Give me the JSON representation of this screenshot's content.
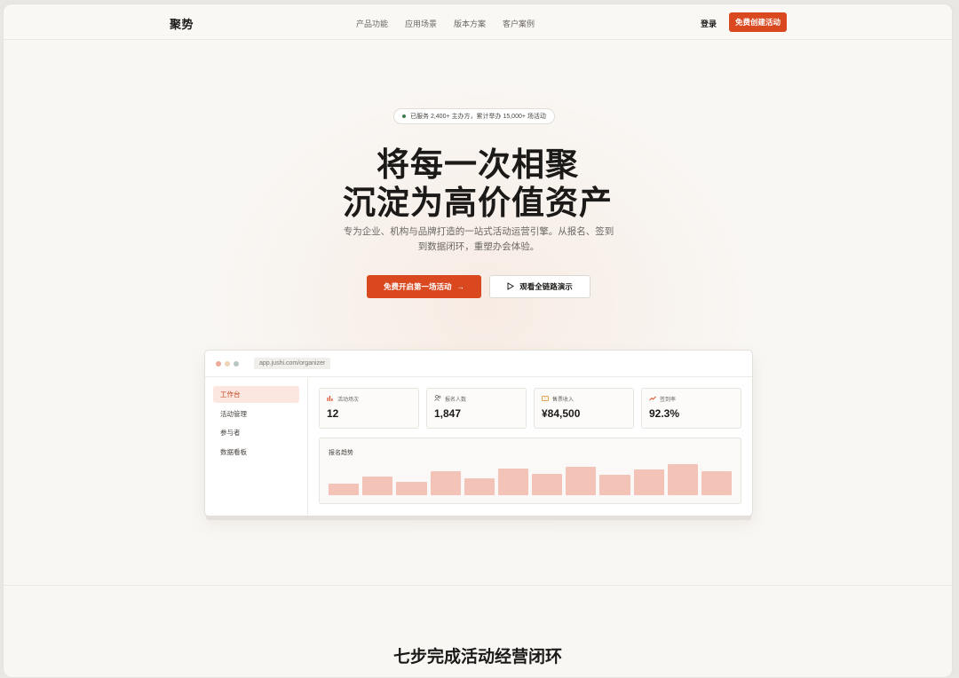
{
  "nav": {
    "logo": "聚势",
    "links": [
      "产品功能",
      "应用场景",
      "版本方案",
      "客户案例"
    ],
    "login": "登录",
    "cta": "免费创建活动"
  },
  "hero": {
    "badge": "已服务 2,400+ 主办方，累计举办 15,000+ 场活动",
    "title_line1": "将每一次相聚",
    "title_line2": "沉淀为高价值资产",
    "subtitle": "专为企业、机构与品牌打造的一站式活动运营引擎。从报名、签到到数据闭环，重塑办会体验。",
    "primary_button": "免费开启第一场活动",
    "secondary_button": "观看全链路演示"
  },
  "preview": {
    "url": "app.jushi.com/organizer",
    "sidebar": [
      "工作台",
      "活动管理",
      "参与者",
      "数据看板"
    ],
    "stats": [
      {
        "label": "活动场次",
        "value": "12",
        "icon": "bar-chart-icon"
      },
      {
        "label": "报名人数",
        "value": "1,847",
        "icon": "users-icon"
      },
      {
        "label": "售票收入",
        "value": "¥84,500",
        "icon": "ticket-icon"
      },
      {
        "label": "签到率",
        "value": "92.3%",
        "icon": "trend-up-icon"
      }
    ],
    "trend_title": "报名趋势"
  },
  "chart_data": {
    "type": "bar",
    "title": "报名趋势",
    "values": [
      0.36,
      0.58,
      0.42,
      0.74,
      0.52,
      0.84,
      0.68,
      0.9,
      0.64,
      0.8,
      0.96,
      0.76
    ]
  },
  "section": {
    "title": "七步完成活动经营闭环"
  },
  "colors": {
    "accent": "#d9481f",
    "bar": "#f2c3b6",
    "background": "#f9f7f4"
  }
}
